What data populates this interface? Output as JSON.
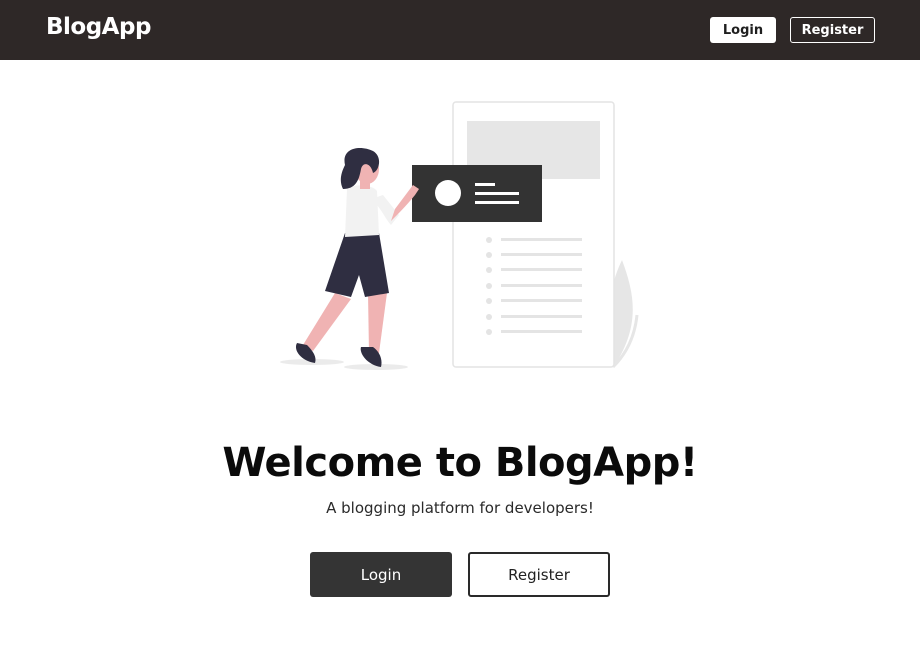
{
  "navbar": {
    "brand": "BlogApp",
    "login_label": "Login",
    "register_label": "Register"
  },
  "hero": {
    "title": "Welcome to BlogApp!",
    "subtitle": "A blogging platform for developers!",
    "login_label": "Login",
    "register_label": "Register",
    "illustration": "woman-with-blog-post-illustration"
  },
  "colors": {
    "navbar_bg": "#2e2827",
    "primary_button": "#343434",
    "accent_skin": "#f0b3b3",
    "figure_dark": "#2f2e41"
  }
}
